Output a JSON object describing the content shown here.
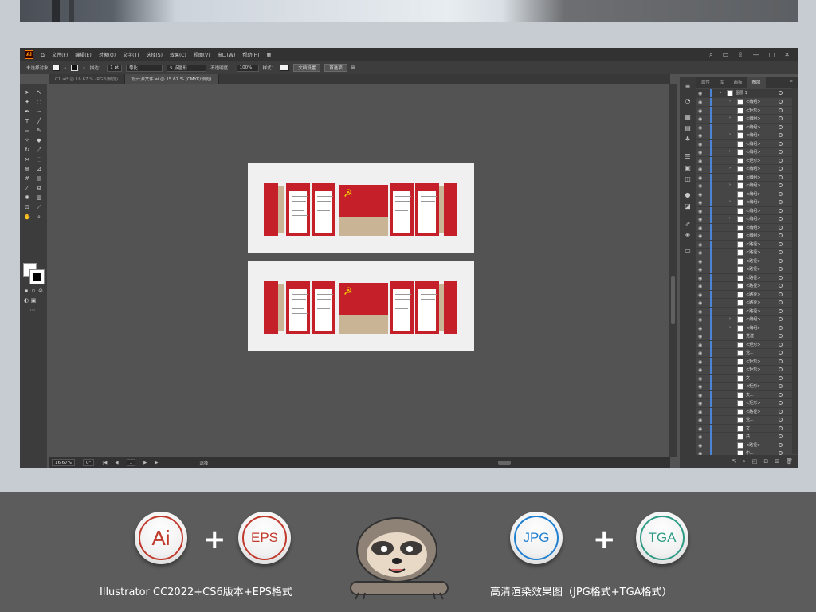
{
  "app": {
    "logo_text": "Ai",
    "menus": [
      "文件(F)",
      "编辑(E)",
      "对象(O)",
      "文字(T)",
      "选择(S)",
      "效果(C)",
      "视图(V)",
      "窗口(W)",
      "帮助(H)"
    ],
    "window_controls": [
      "—",
      "□",
      "✕"
    ]
  },
  "control_bar": {
    "selection_label": "未选择对象",
    "stroke_label": "描边：",
    "stroke_value": "1 pt",
    "stroke_style": "等比",
    "brush": "5 点圆形",
    "opacity_label": "不透明度：",
    "opacity_value": "100%",
    "style_label": "样式：",
    "doc_setup": "文档设置",
    "preferences": "首选项"
  },
  "tabs": [
    {
      "label": "C1.ai* @ 16.67 % (RGB/预览)"
    },
    {
      "label": "设计源文件.ai @ 15.67 % (CMYK/预览)"
    }
  ],
  "status": {
    "zoom": "16.67%",
    "rotation": "0°",
    "artboard": "1",
    "tool": "选择"
  },
  "layers_panel": {
    "tabs": [
      "属性",
      "库",
      "画板",
      "图层"
    ],
    "active_tab": "图层",
    "layer_name": "图层 1",
    "rows": [
      "<编组>",
      "<矩形>",
      "<编组>",
      "<编组>",
      "<编组>",
      "<编组>",
      "<编组>",
      "<矩形>",
      "<编组>",
      "<编组>",
      "<编组>",
      "<编组>",
      "<编组>",
      "<编组>",
      "<编组>",
      "<编组>",
      "<编组>",
      "<路径>",
      "<路径>",
      "<路径>",
      "<路径>",
      "<路径>",
      "<路径>",
      "<路径>",
      "<路径>",
      "<路径>",
      "<编组>",
      "<编组>",
      "党建",
      "<矩形>",
      "党...",
      "<矩形>",
      "<矩形>",
      "文",
      "<矩形>",
      "文...",
      "<矩形>",
      "<路径>",
      "党...",
      "文",
      "共...",
      "<路径>",
      "中..."
    ]
  },
  "formats": {
    "left_caption": "Illustrator CC2022+CS6版本+EPS格式",
    "right_caption": "高清渲染效果图（JPG格式+TGA格式）",
    "badges": [
      {
        "label": "Ai",
        "color": "#c0392b"
      },
      {
        "label": "EPS",
        "color": "#c0392b"
      },
      {
        "label": "JPG",
        "color": "#1f7fd1"
      },
      {
        "label": "TGA",
        "color": "#2e9b84"
      }
    ],
    "plus": "+"
  }
}
